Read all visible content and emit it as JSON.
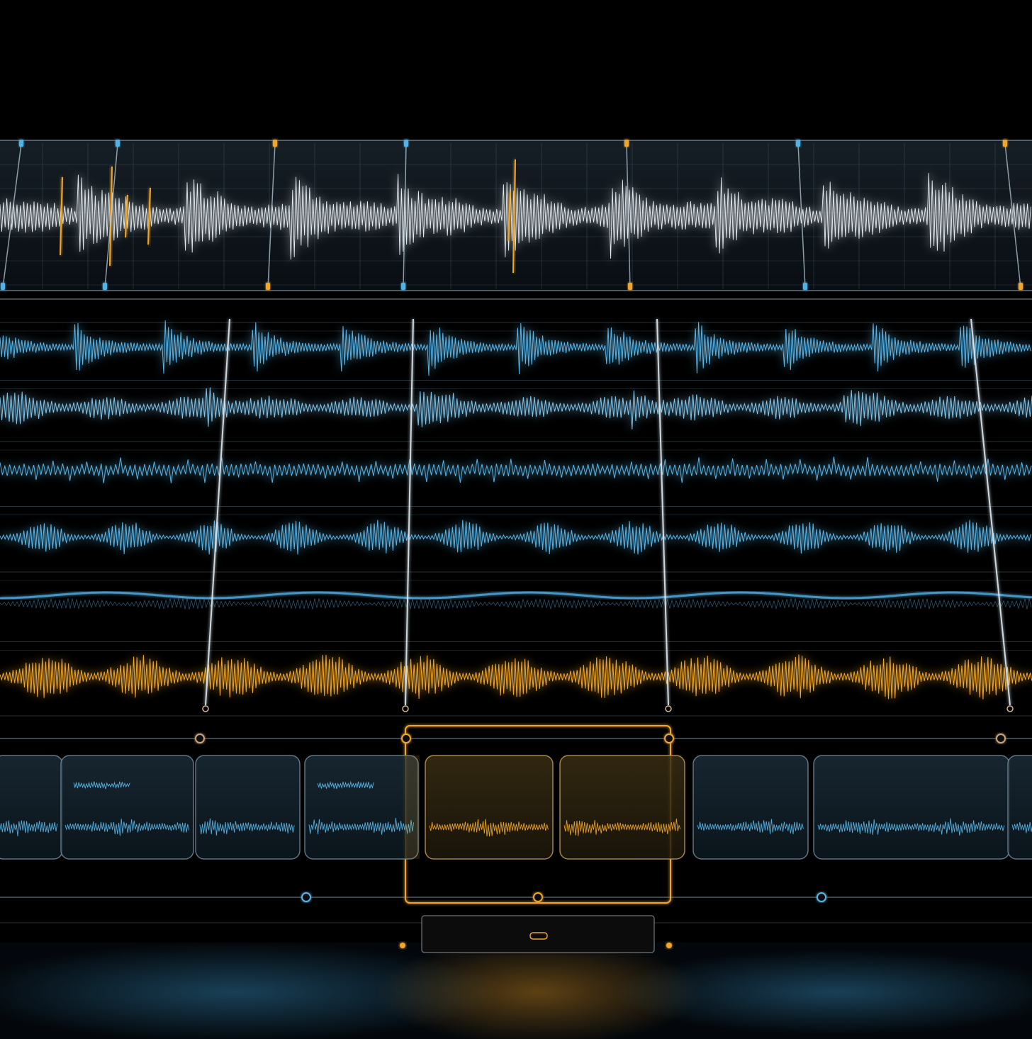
{
  "theme": {
    "background": "#000000",
    "white_wave": "#e6ecf0",
    "blue_wave": "#5ab4e6",
    "orange_wave": "#f0a62a",
    "panel_border": "#6f8796"
  },
  "main_track": {
    "marker_colors": [
      "#4fb3e8",
      "#4fb3e8",
      "#f0a62a",
      "#4fb3e8",
      "#f0a62a",
      "#4fb3e8",
      "#f0a62a"
    ]
  },
  "tracks": [
    {
      "color": "#5ab4e6",
      "style": "bursts"
    },
    {
      "color": "#7fc4ea",
      "style": "dense"
    },
    {
      "color": "#5ab4e6",
      "style": "spikes"
    },
    {
      "color": "#5ab4e6",
      "style": "packets"
    },
    {
      "color": "#4c9dcc",
      "style": "smooth"
    },
    {
      "color": "#f0a62a",
      "style": "packets"
    }
  ],
  "clip_strip": {
    "clip_count": 9,
    "selected_range": "orange"
  }
}
